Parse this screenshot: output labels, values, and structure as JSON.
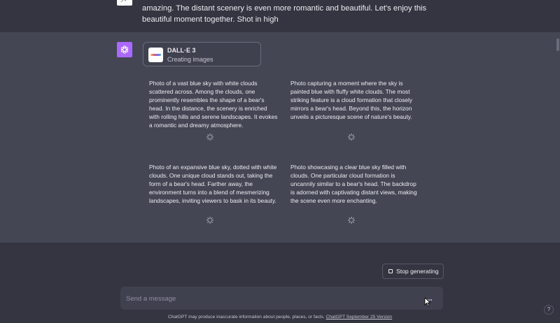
{
  "conversation": {
    "user_message_tail": "amazing. The distant scenery is even more romantic and beautiful. Let's enjoy this beautiful moment together. Shot in high",
    "tool_card": {
      "title": "DALL·E 3",
      "status": "Creating images"
    },
    "prompts": [
      "Photo of a vast blue sky with white clouds scattered across. Among the clouds, one prominently resembles the shape of a bear's head. In the distance, the scenery is enriched with rolling hills and serene landscapes. It evokes a romantic and dreamy atmosphere.",
      "Photo capturing a moment where the sky is painted blue with fluffy white clouds. The most striking feature is a cloud formation that closely mirrors a bear's head. Beyond this, the horizon unveils a picturesque scene of nature's beauty.",
      "Photo of an expansive blue sky, dotted with white clouds. One unique cloud stands out, taking the form of a bear's head. Farther away, the environment turns into a blend of mesmerizing landscapes, inviting viewers to bask in its beauty.",
      "Photo showcasing a clear blue sky filled with clouds. One particular cloud formation is uncannily similar to a bear's head. The backdrop is adorned with captivating distant views, making the scene even more enchanting."
    ]
  },
  "controls": {
    "stop_label": "Stop generating",
    "input_placeholder": "Send a message",
    "help_label": "?"
  },
  "footer": {
    "disclaimer": "ChatGPT may produce inaccurate information about people, places, or facts.",
    "version_link": "ChatGPT September 25 Version"
  },
  "colors": {
    "background": "#343541",
    "assistant_background": "#444654",
    "gpt_avatar": "#ab68ff"
  },
  "icons": {
    "user": "user-avatar-icon",
    "assistant": "openai-logo-icon",
    "loading": "loading-spinner-icon",
    "stop": "stop-square-icon",
    "cursor": "mouse-pointer-icon"
  }
}
